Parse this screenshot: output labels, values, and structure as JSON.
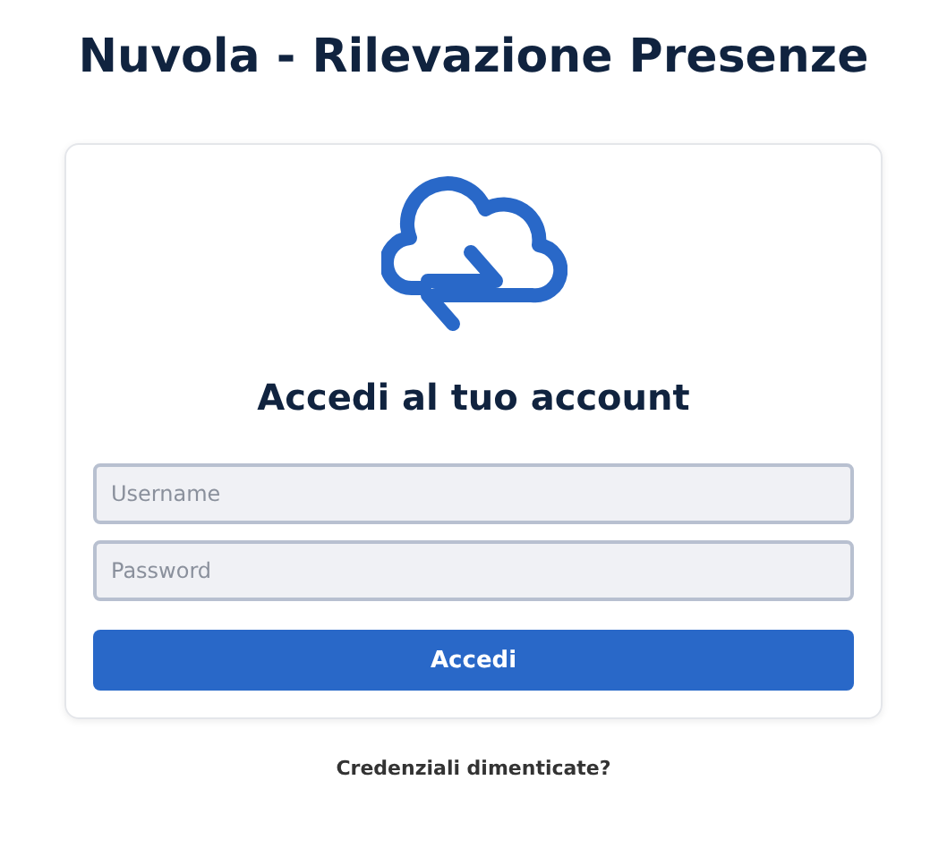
{
  "app_title": "Nuvola - Rilevazione Presenze",
  "login": {
    "heading": "Accedi al tuo account",
    "fields": [
      {
        "placeholder": "Username"
      },
      {
        "placeholder": "Password"
      }
    ],
    "submit": "Accedi"
  },
  "forgot_link": "Credenziali dimenticate?"
}
